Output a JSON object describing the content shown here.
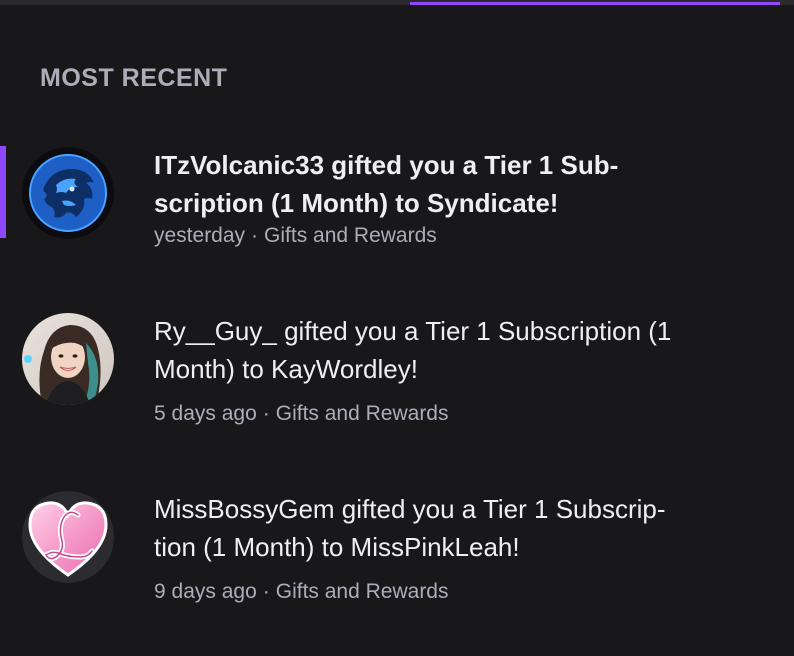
{
  "section": {
    "title": "MOST RECENT"
  },
  "notifications": [
    {
      "line1": "ITzVolcanic33 gifted you a Tier 1 Sub-",
      "line2": "scription (1 Month) to Syndicate!",
      "time": "yesterday",
      "category": "Gifts and Rewards",
      "unread": true,
      "avatar_icon": "blue-lion-logo-icon"
    },
    {
      "line1": "Ry__Guy_ gifted you a Tier 1 Subscription (1",
      "line2": "Month) to KayWordley!",
      "time": "5 days ago",
      "category": "Gifts and Rewards",
      "unread": false,
      "avatar_icon": "user-photo-avatar"
    },
    {
      "line1": "MissBossyGem gifted you a Tier 1 Subscrip-",
      "line2": "tion (1 Month) to MissPinkLeah!",
      "time": "9 days ago",
      "category": "Gifts and Rewards",
      "unread": false,
      "avatar_icon": "pink-heart-letter-l-icon"
    }
  ],
  "separator": "·",
  "colors": {
    "background": "#18181b",
    "accent": "#9147ff",
    "text_primary": "#efeff1",
    "text_muted": "#adadb8"
  }
}
